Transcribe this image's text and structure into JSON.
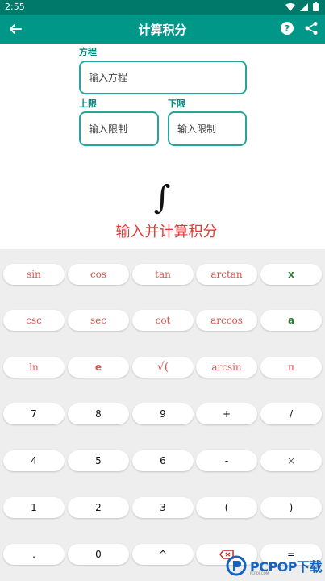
{
  "status_bar": {
    "time": "2:55"
  },
  "app_bar": {
    "title": "计算积分"
  },
  "form": {
    "equation_label": "方程",
    "equation_placeholder": "输入方程",
    "upper_label": "上限",
    "upper_placeholder": "输入限制",
    "lower_label": "下限",
    "lower_placeholder": "输入限制"
  },
  "integral_symbol": "∫",
  "prompt": "输入并计算积分",
  "keyboard": {
    "rows": [
      [
        "sin",
        "cos",
        "tan",
        "arctan",
        "x"
      ],
      [
        "csc",
        "sec",
        "cot",
        "arccos",
        "a"
      ],
      [
        "ln",
        "e",
        "√(",
        "arcsin",
        "π"
      ],
      [
        "7",
        "8",
        "9",
        "+",
        "/"
      ],
      [
        "4",
        "5",
        "6",
        "-",
        "×"
      ],
      [
        "1",
        "2",
        "3",
        "(",
        ")"
      ],
      [
        ".",
        "0",
        "^",
        "",
        "="
      ]
    ]
  },
  "watermark": {
    "brand": "PCPOP下载",
    "sub": "PCPOP.COM"
  },
  "colors": {
    "primary": "#009688",
    "primary_dark": "#00796b",
    "accent_red": "#e53935"
  }
}
